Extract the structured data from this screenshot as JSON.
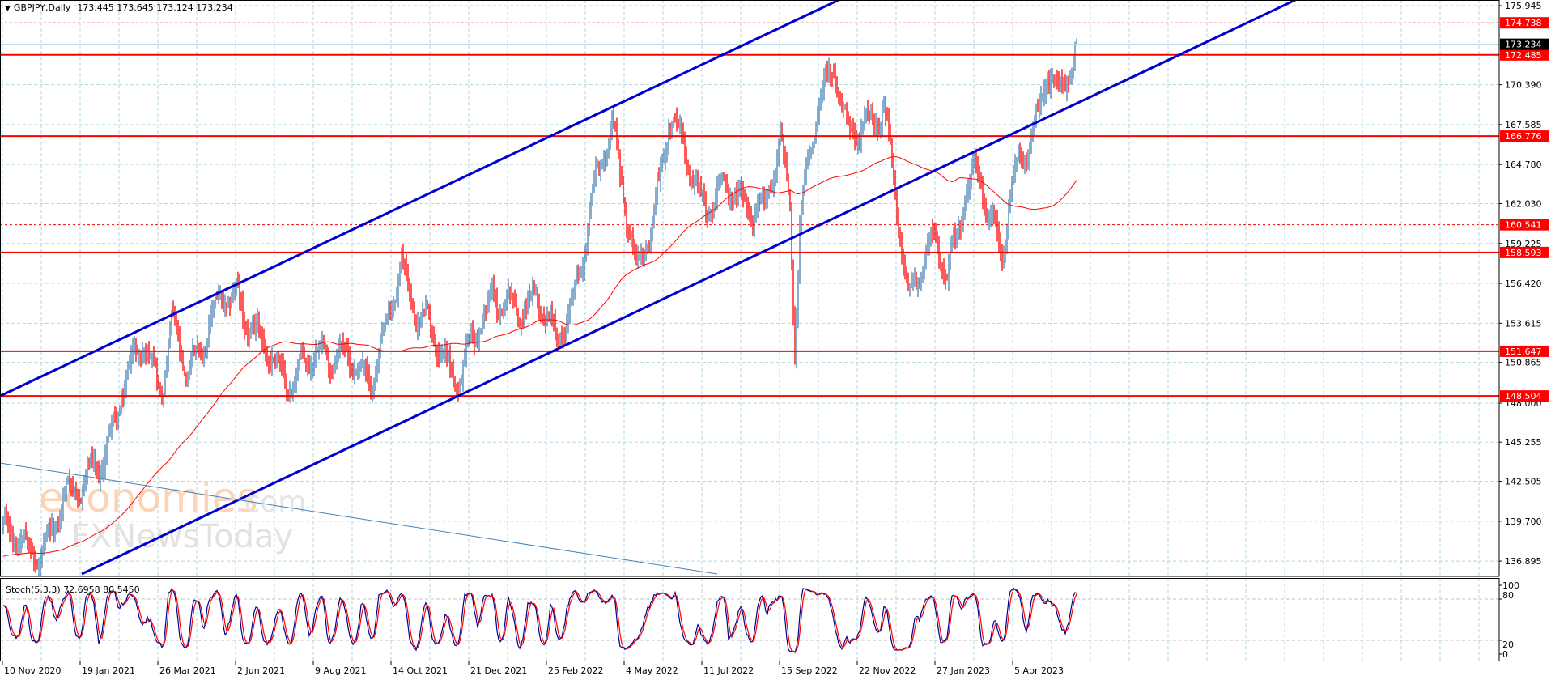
{
  "header": {
    "arrow": "▼",
    "symbol_timeframe": "GBPJPY,Daily",
    "ohlc": "173.445 173.645 173.124 173.234"
  },
  "watermark": {
    "brand1": "economies",
    "brand1_suffix": ".com",
    "brand2": "FXNewsToday"
  },
  "colors": {
    "up": "#4682B4",
    "down": "#FF0000",
    "ma": "#FF0000",
    "channel": "#0000CD",
    "thin_trend": "#4682B4",
    "level": "#FF0000",
    "stoch_k": "#00008B",
    "stoch_d": "#FF0000",
    "grid": "#B0D8DF"
  },
  "chart_data": {
    "type": "candlestick",
    "symbol": "GBPJPY",
    "timeframe": "Daily",
    "ylim": [
      136.0,
      176.3
    ],
    "y_ticks": [
      "175.945",
      "170.390",
      "167.585",
      "164.780",
      "162.030",
      "159.225",
      "156.420",
      "153.615",
      "150.865",
      "148.000",
      "145.255",
      "142.505",
      "139.700",
      "136.895"
    ],
    "x_ticks": [
      "10 Nov 2020",
      "19 Jan 2021",
      "26 Mar 2021",
      "2 Jun 2021",
      "9 Aug 2021",
      "14 Oct 2021",
      "21 Dec 2021",
      "25 Feb 2022",
      "4 May 2022",
      "11 Jul 2022",
      "15 Sep 2022",
      "22 Nov 2022",
      "27 Jan 2023",
      "5 Apr 2023"
    ],
    "bars_per_x_tick": 48,
    "bar_count": 664,
    "close_path_bar_price": [
      [
        0,
        138.8
      ],
      [
        27,
        137.5
      ],
      [
        40,
        142
      ],
      [
        61,
        143.3
      ],
      [
        73,
        149.2
      ],
      [
        86,
        152
      ],
      [
        98,
        149.5
      ],
      [
        104,
        153.4
      ],
      [
        113,
        150
      ],
      [
        128,
        154
      ],
      [
        144,
        155.8
      ],
      [
        159,
        152
      ],
      [
        180,
        149.5
      ],
      [
        196,
        152
      ],
      [
        226,
        150
      ],
      [
        235,
        152
      ],
      [
        246,
        157.9
      ],
      [
        257,
        154
      ],
      [
        269,
        152
      ],
      [
        281,
        149.8
      ],
      [
        290,
        152
      ],
      [
        302,
        156
      ],
      [
        318,
        154
      ],
      [
        330,
        156
      ],
      [
        342,
        152
      ],
      [
        351,
        155
      ],
      [
        360,
        160
      ],
      [
        376,
        168
      ],
      [
        382,
        164
      ],
      [
        391,
        157
      ],
      [
        400,
        160
      ],
      [
        411,
        168.3
      ],
      [
        422,
        165
      ],
      [
        434,
        162
      ],
      [
        452,
        163
      ],
      [
        470,
        161
      ],
      [
        480,
        167
      ],
      [
        486,
        162
      ],
      [
        489,
        151.5
      ],
      [
        492,
        160
      ],
      [
        504,
        170
      ],
      [
        513,
        171.8
      ],
      [
        522,
        166
      ],
      [
        532,
        168
      ],
      [
        544,
        168.5
      ],
      [
        550,
        163
      ],
      [
        559,
        156
      ],
      [
        568,
        158
      ],
      [
        577,
        159
      ],
      [
        583,
        157.5
      ],
      [
        593,
        162
      ],
      [
        602,
        164
      ],
      [
        611,
        161
      ],
      [
        617,
        159
      ],
      [
        623,
        163
      ],
      [
        632,
        166
      ],
      [
        638,
        168
      ],
      [
        645,
        171.5
      ],
      [
        651,
        169
      ],
      [
        657,
        171
      ],
      [
        663,
        173.234
      ]
    ],
    "last_price": "173.234",
    "horizontal_levels": [
      {
        "price": "174.738",
        "style": "dotted"
      },
      {
        "price": "172.485",
        "style": "solid"
      },
      {
        "price": "166.776",
        "style": "solid"
      },
      {
        "price": "160.541",
        "style": "dotted"
      },
      {
        "price": "158.593",
        "style": "solid"
      },
      {
        "price": "151.647",
        "style": "solid"
      },
      {
        "price": "148.504",
        "style": "solid"
      }
    ],
    "trendlines": [
      {
        "name": "channel-upper",
        "from": [
          -2,
          148.5
        ],
        "to": [
          516,
          176.34
        ],
        "weight": "thick"
      },
      {
        "name": "channel-lower",
        "from": [
          48.5,
          135.99
        ],
        "to": [
          798,
          176.34
        ],
        "weight": "thick"
      },
      {
        "name": "thin-downtrend",
        "from": [
          -2,
          143.79
        ],
        "to": [
          441,
          135.99
        ],
        "weight": "thin"
      }
    ],
    "moving_average_period": 100,
    "indicator": {
      "label": "Stoch(5,3,3) 72.6958 80.5450",
      "k": 72.6958,
      "d": 80.545,
      "levels": [
        "100",
        "80",
        "20",
        "0"
      ],
      "ylim": [
        0,
        100
      ]
    }
  }
}
